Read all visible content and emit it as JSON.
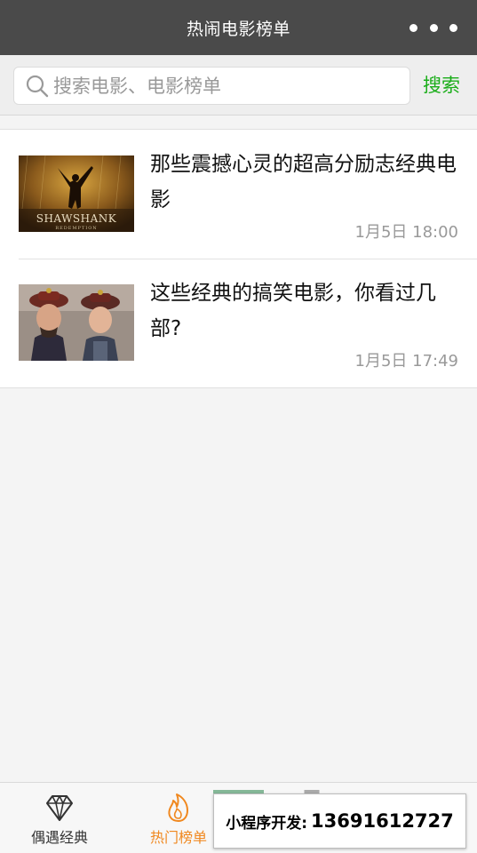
{
  "app": {
    "title": "热闹电影榜单"
  },
  "search": {
    "placeholder": "搜索电影、电影榜单",
    "value": "",
    "button_label": "搜索",
    "accent_color": "#1aad19"
  },
  "articles": [
    {
      "title": "那些震撼心灵的超高分励志经典电影",
      "time": "1月5日 18:00",
      "thumb_caption": "SHAWSHANK",
      "thumb_subcaption": "REDEMPTION"
    },
    {
      "title": "这些经典的搞笑电影，你看过几部?",
      "time": "1月5日 17:49"
    }
  ],
  "tabbar": {
    "tabs": [
      {
        "label": "偶遇经典",
        "icon": "diamond-icon",
        "active": false
      },
      {
        "label": "热门榜单",
        "icon": "flame-icon",
        "active": true
      }
    ],
    "active_color": "#f0881f"
  },
  "promo": {
    "label": "小程序开发:",
    "phone": "13691612727"
  }
}
